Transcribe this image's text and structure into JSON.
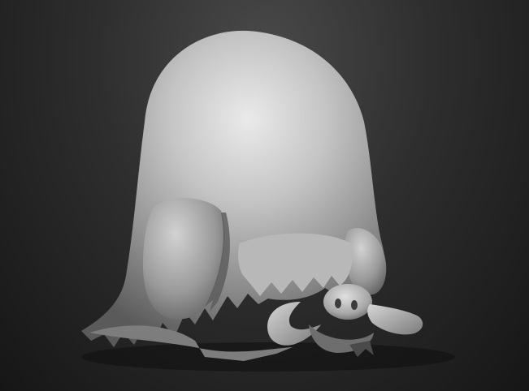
{
  "scene": {
    "subject": "sculpt-render",
    "background_top": "#4a4a4a",
    "background_bottom": "#161616",
    "material_light": "#e6e6e6",
    "material_mid": "#a8a8a8",
    "material_dark": "#4a4a4a"
  }
}
